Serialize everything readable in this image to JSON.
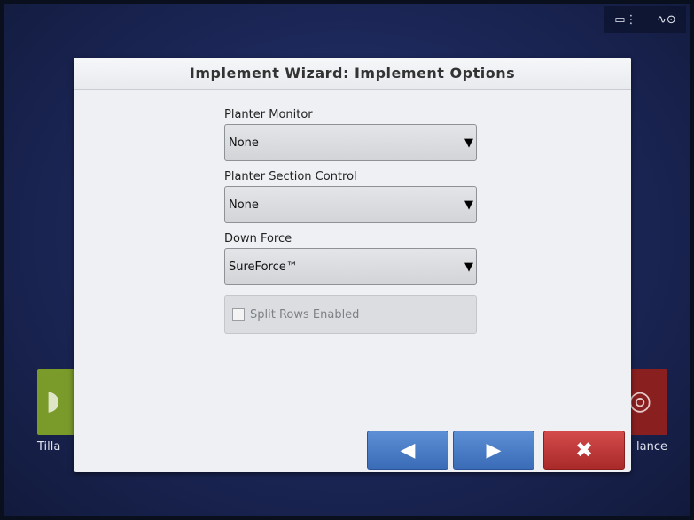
{
  "dialog": {
    "title": "Implement Wizard:  Implement Options"
  },
  "fields": {
    "planter_monitor": {
      "label": "Planter Monitor",
      "value": "None"
    },
    "planter_section_control": {
      "label": "Planter Section Control",
      "value": "None"
    },
    "down_force": {
      "label": "Down Force",
      "value": "SureForce™"
    }
  },
  "split_rows": {
    "label": "Split Rows Enabled",
    "checked": false,
    "enabled": false
  },
  "dropdown_arrow": "▼",
  "buttons": {
    "back_glyph": "◀",
    "next_glyph": "▶",
    "cancel_glyph": "✖"
  },
  "background_tiles": {
    "left_label": "Tilla",
    "right_label": "lance"
  },
  "status_icons": [
    "monitor-icon",
    "gps-satellite-icon"
  ],
  "colors": {
    "nav_blue": "#4a7cc7",
    "cancel_red": "#c03a3a",
    "dialog_bg": "#eef0f3"
  }
}
